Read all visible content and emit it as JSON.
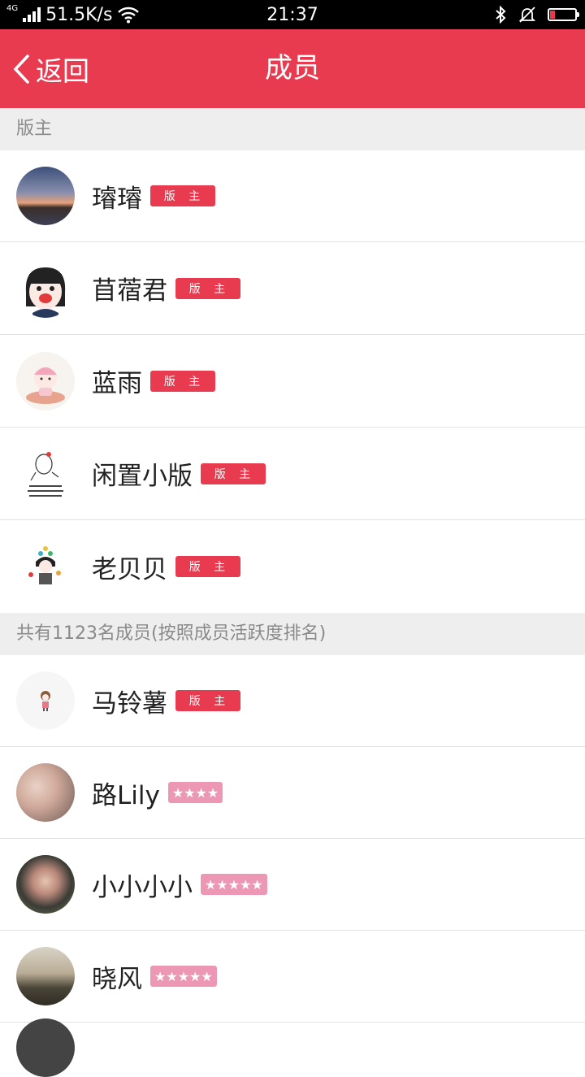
{
  "status_bar": {
    "network": "4G",
    "speed": "51.5K/s",
    "time": "21:37"
  },
  "header": {
    "back_label": "返回",
    "title": "成员"
  },
  "moderators_section": {
    "title": "版主",
    "members": [
      {
        "name": "璿璿",
        "badge": "版 主"
      },
      {
        "name": "苜蓿君",
        "badge": "版 主"
      },
      {
        "name": "蓝雨",
        "badge": "版 主"
      },
      {
        "name": "闲置小版",
        "badge": "版 主"
      },
      {
        "name": "老贝贝",
        "badge": "版 主"
      }
    ]
  },
  "members_section": {
    "title": "共有1123名成员(按照成员活跃度排名)",
    "members": [
      {
        "name": "马铃薯",
        "badge": "版 主"
      },
      {
        "name": "路Lily",
        "stars": 4,
        "star_text": "★★★★"
      },
      {
        "name": "小小小小",
        "stars": 5,
        "star_text": "★★★★★"
      },
      {
        "name": "晓风",
        "stars": 5,
        "star_text": "★★★★★"
      }
    ]
  },
  "colors": {
    "accent": "#e93b4f",
    "star_badge": "#ec98b4",
    "section_bg": "#eeeeee"
  }
}
